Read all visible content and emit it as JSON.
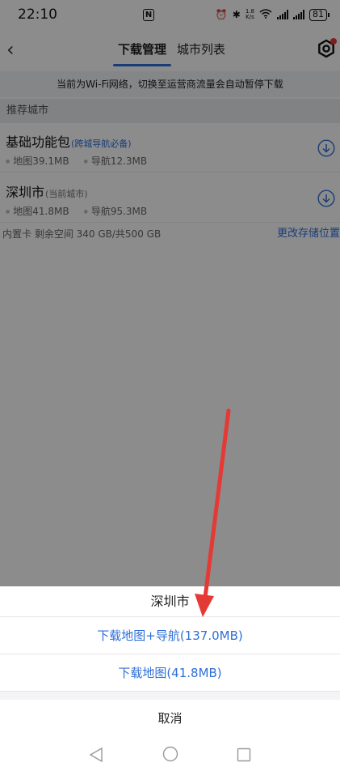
{
  "status_bar": {
    "time": "22:10",
    "nfc": "N",
    "speed_value": "1.8",
    "speed_unit": "K/s",
    "battery": "81"
  },
  "nav": {
    "tabs": [
      {
        "label": "下载管理",
        "active": true
      },
      {
        "label": "城市列表",
        "active": false
      }
    ]
  },
  "notice": "当前为Wi-Fi网络，切换至运营商流量会自动暂停下载",
  "section_header": "推荐城市",
  "cities": [
    {
      "name": "基础功能包",
      "tag": "(跨城导航必备)",
      "map_size": "地图39.1MB",
      "nav_size": "导航12.3MB"
    },
    {
      "name": "深圳市",
      "tag": "(当前城市)",
      "map_size": "地图41.8MB",
      "nav_size": "导航95.3MB"
    }
  ],
  "storage": {
    "info": "内置卡 剩余空间 340 GB/共500 GB",
    "change_link": "更改存储位置"
  },
  "sheet": {
    "title": "深圳市",
    "option_full": "下载地图+导航(137.0MB)",
    "option_map": "下载地图(41.8MB)",
    "cancel": "取消"
  },
  "colors": {
    "accent": "#2f6fd8",
    "arrow": "#e53935",
    "overlay": "rgba(0,0,0,0.45)"
  },
  "icons": [
    "back-icon",
    "gear-icon",
    "download-icon",
    "nav-back-icon",
    "nav-home-icon",
    "nav-recent-icon"
  ]
}
